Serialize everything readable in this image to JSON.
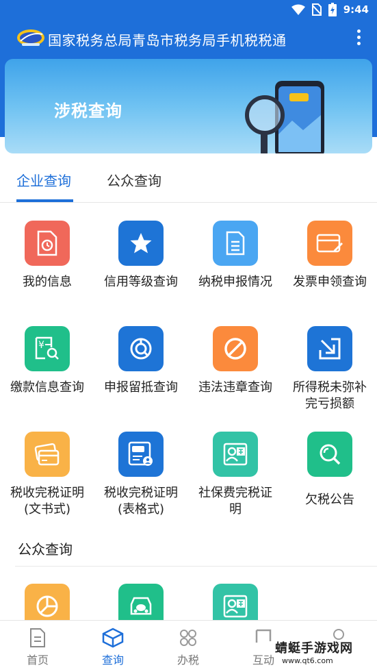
{
  "status_bar": {
    "time": "9:44"
  },
  "app_bar": {
    "title": "国家税务总局青岛市税务局手机税税通"
  },
  "banner": {
    "title": "涉税查询"
  },
  "tabs": [
    {
      "label": "企业查询"
    },
    {
      "label": "公众查询"
    }
  ],
  "enterprise_items": [
    {
      "label": "我的信息",
      "color": "#f0685a",
      "icon": "document-clock-icon"
    },
    {
      "label": "信用等级查询",
      "color": "#1e74d6",
      "icon": "star-icon"
    },
    {
      "label": "纳税申报情况",
      "color": "#4aa6f2",
      "icon": "document-list-icon"
    },
    {
      "label": "发票申领查询",
      "color": "#fb8a3c",
      "icon": "card-pen-icon"
    },
    {
      "label": "缴款信息查询",
      "color": "#20bf8a",
      "icon": "yuan-search-icon"
    },
    {
      "label": "申报留抵查询",
      "color": "#1e74d6",
      "icon": "ring-chart-icon"
    },
    {
      "label": "违法违章查询",
      "color": "#fb8a3c",
      "icon": "prohibited-icon"
    },
    {
      "label": "所得税未弥补\n完亏损额",
      "color": "#1e74d6",
      "icon": "arrow-down-right-icon"
    },
    {
      "label": "税收完税证明\n(文书式)",
      "color": "#f9b247",
      "icon": "card-document-icon"
    },
    {
      "label": "税收完税证明\n(表格式)",
      "color": "#1e74d6",
      "icon": "certificate-user-icon"
    },
    {
      "label": "社保费完税证\n明",
      "color": "#32c3a6",
      "icon": "person-insurance-icon"
    },
    {
      "label": "欠税公告",
      "color": "#20bf8a",
      "icon": "magnifier-icon"
    }
  ],
  "public_section": {
    "title": "公众查询"
  },
  "public_items": [
    {
      "color": "#f9b247",
      "icon": "pie-chart-icon"
    },
    {
      "color": "#20bf8a",
      "icon": "car-tax-icon"
    },
    {
      "color": "#32c3a6",
      "icon": "person-insurance-icon"
    }
  ],
  "bottom_nav": [
    {
      "label": "首页",
      "icon": "home-document-icon"
    },
    {
      "label": "查询",
      "icon": "cube-icon",
      "active": true
    },
    {
      "label": "办税",
      "icon": "grid-apps-icon"
    },
    {
      "label": "互动",
      "icon": "chat-icon"
    },
    {
      "label": "",
      "icon": "user-icon"
    }
  ],
  "watermark": {
    "main": "蜻蜓手游戏网",
    "sub": "www.qt6.com"
  }
}
